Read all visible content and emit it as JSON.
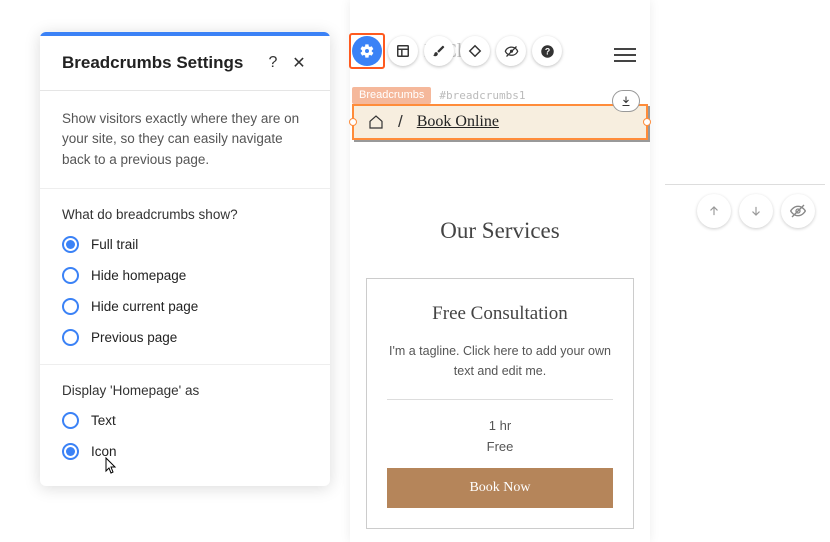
{
  "panel": {
    "title": "Breadcrumbs Settings",
    "description": "Show visitors exactly where they are on your site, so they can easily navigate back to a previous page.",
    "show_section": {
      "label": "What do breadcrumbs show?",
      "options": [
        {
          "label": "Full trail",
          "checked": true
        },
        {
          "label": "Hide homepage",
          "checked": false
        },
        {
          "label": "Hide current page",
          "checked": false
        },
        {
          "label": "Previous page",
          "checked": false
        }
      ]
    },
    "display_section": {
      "label": "Display 'Homepage' as",
      "options": [
        {
          "label": "Text",
          "checked": false
        },
        {
          "label": "Icon",
          "checked": true
        }
      ]
    },
    "help_symbol": "?",
    "close_symbol": "✕"
  },
  "preview": {
    "header_behind": "H        Cl",
    "tag_label": "Breadcrumbs",
    "tag_id": "#breadcrumbs1",
    "breadcrumb": {
      "separator": "/",
      "current": "Book Online"
    },
    "section_title": "Our Services",
    "service": {
      "title": "Free Consultation",
      "tagline": "I'm a tagline. Click here to add your own text and edit me.",
      "duration": "1 hr",
      "price": "Free",
      "button": "Book Now"
    }
  }
}
